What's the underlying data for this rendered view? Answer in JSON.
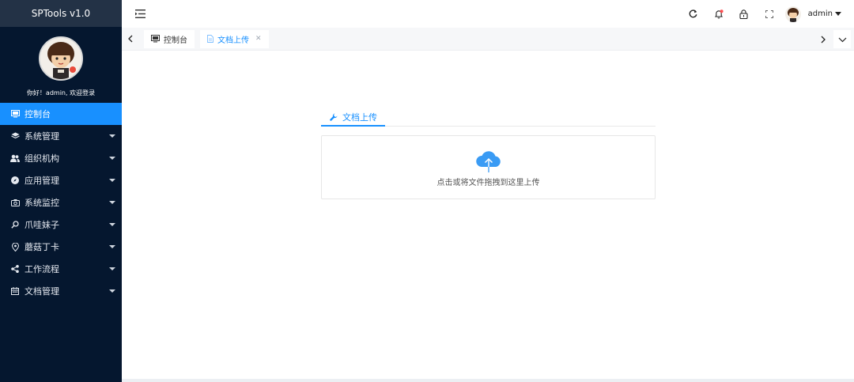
{
  "app": {
    "title": "SPTools v1.0",
    "welcome": "你好！admin, 欢迎登录"
  },
  "sidebar": {
    "items": [
      {
        "label": "控制台",
        "icon": "monitor-icon",
        "active": true,
        "has_children": false
      },
      {
        "label": "系统管理",
        "icon": "layers-icon",
        "active": false,
        "has_children": true
      },
      {
        "label": "组织机构",
        "icon": "users-icon",
        "active": false,
        "has_children": true
      },
      {
        "label": "应用管理",
        "icon": "compass-icon",
        "active": false,
        "has_children": true
      },
      {
        "label": "系统监控",
        "icon": "camera-icon",
        "active": false,
        "has_children": true
      },
      {
        "label": "爪哇妹子",
        "icon": "search-person-icon",
        "active": false,
        "has_children": true
      },
      {
        "label": "蘑菇丁卡",
        "icon": "location-pin-icon",
        "active": false,
        "has_children": true
      },
      {
        "label": "工作流程",
        "icon": "share-icon",
        "active": false,
        "has_children": true
      },
      {
        "label": "文档管理",
        "icon": "calendar-icon",
        "active": false,
        "has_children": true
      }
    ]
  },
  "header": {
    "username": "admin",
    "icons": [
      "refresh-icon",
      "bell-icon",
      "lock-icon",
      "fullscreen-icon"
    ]
  },
  "tabs": [
    {
      "label": "控制台",
      "icon": "monitor-icon",
      "active": false,
      "closable": false
    },
    {
      "label": "文档上传",
      "icon": "document-icon",
      "active": true,
      "closable": true,
      "close_glyph": "✕"
    }
  ],
  "upload": {
    "tab_label": "文档上传",
    "drop_text": "点击或将文件拖拽到这里上传"
  },
  "colors": {
    "sidebar_bg": "#05172f",
    "accent": "#1890ff",
    "brand_bg": "#233246",
    "badge": "#ff4d4f"
  }
}
